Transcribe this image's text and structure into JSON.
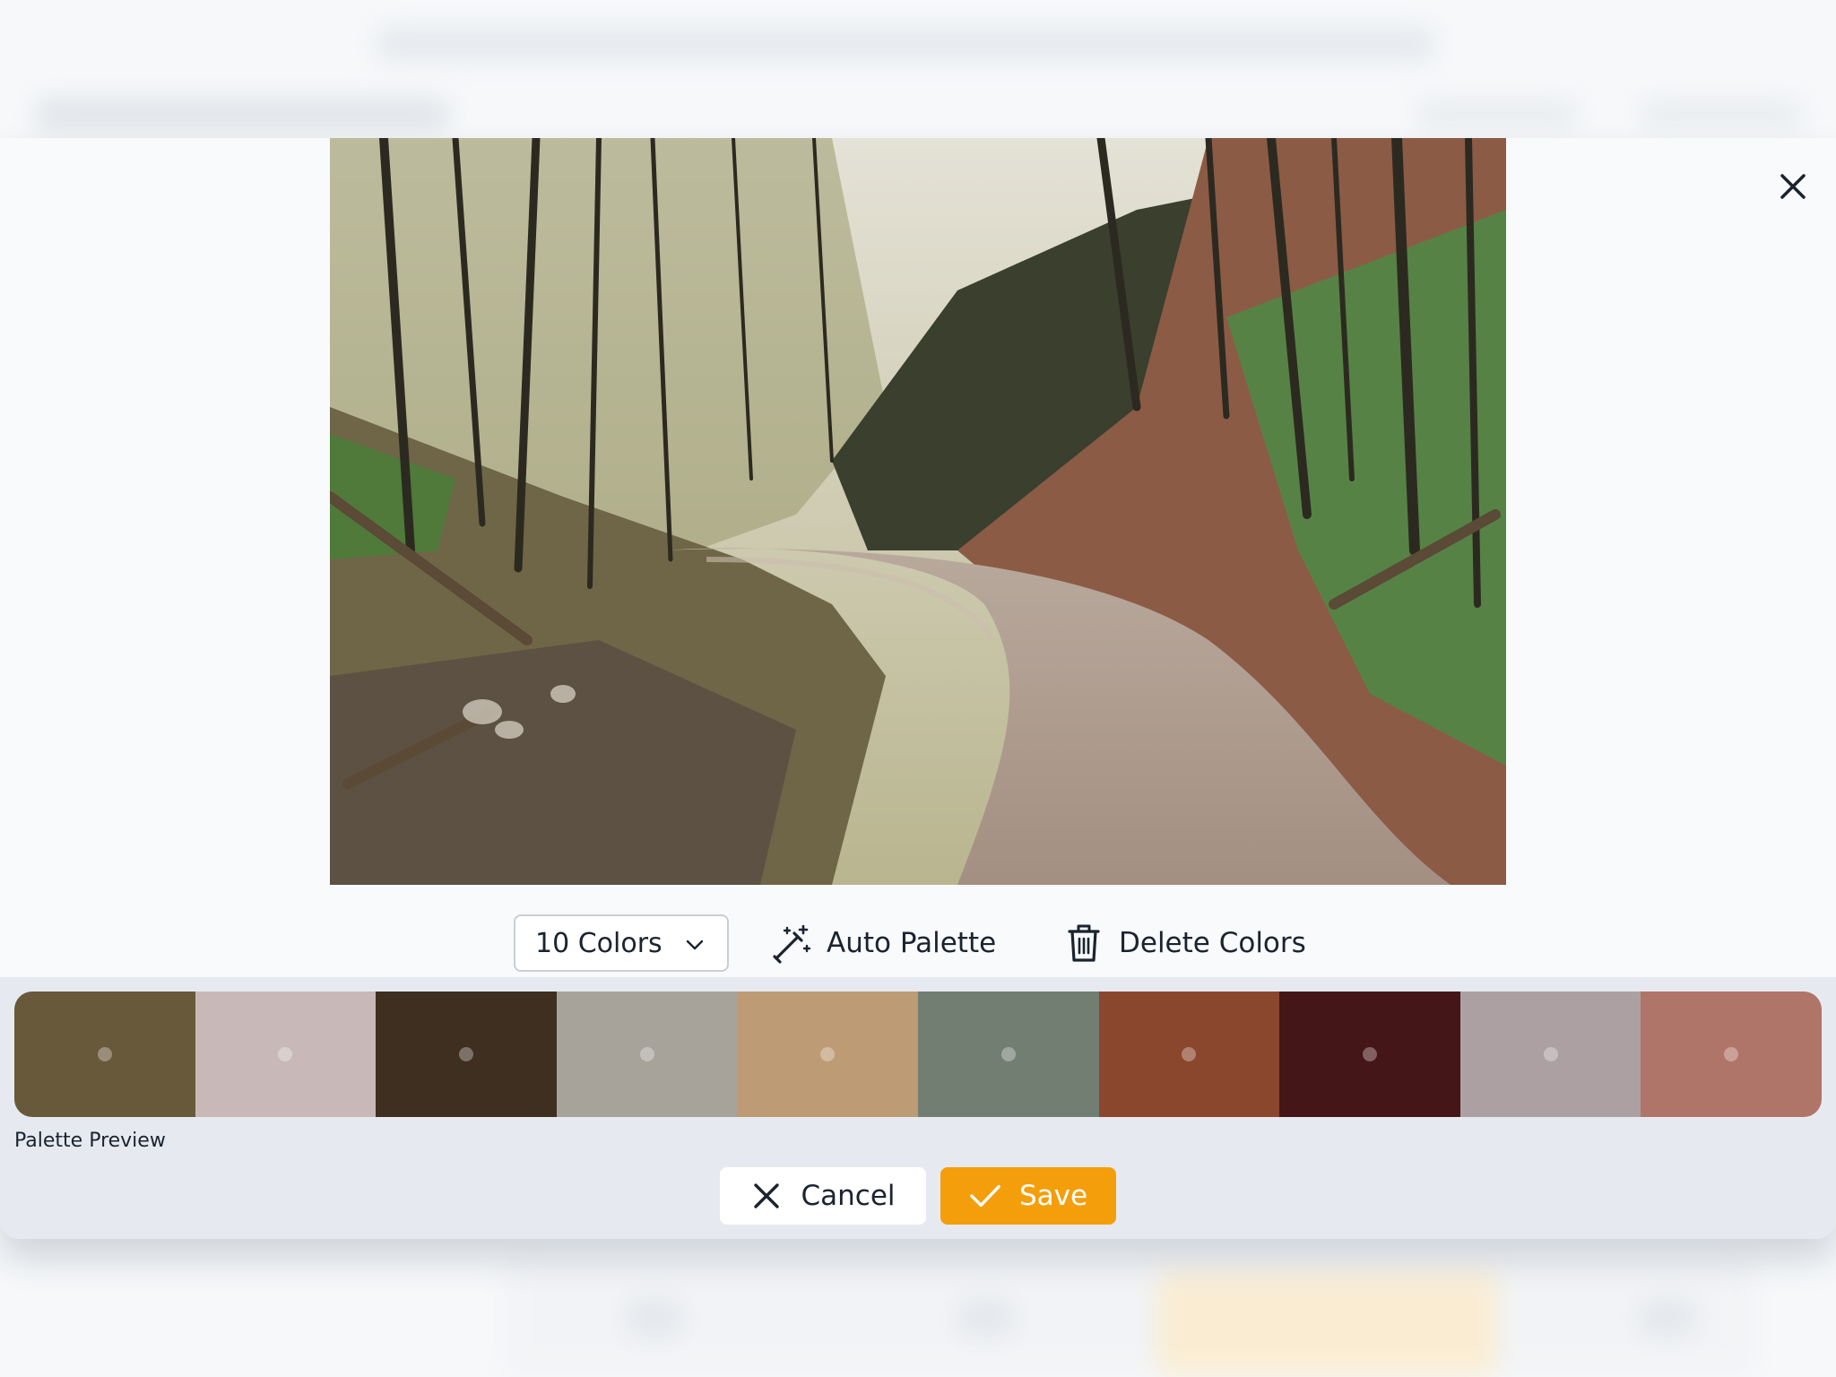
{
  "modal": {
    "close_icon": "close-icon"
  },
  "photo": {
    "subject": "forest-road-photo"
  },
  "toolbar": {
    "color_count": "10 Colors",
    "auto_palette_label": "Auto Palette",
    "auto_palette_icon": "magic-wand-icon",
    "delete_colors_label": "Delete Colors",
    "delete_colors_icon": "trash-icon"
  },
  "palette": {
    "label": "Palette Preview",
    "swatches": [
      "#68593a",
      "#c8b9b8",
      "#3e2f20",
      "#a7a39b",
      "#bd9b74",
      "#727e72",
      "#8b462e",
      "#451617",
      "#ada0a2",
      "#b07569"
    ]
  },
  "actions": {
    "cancel_label": "Cancel",
    "save_label": "Save",
    "save_color": "#f59e0b"
  }
}
